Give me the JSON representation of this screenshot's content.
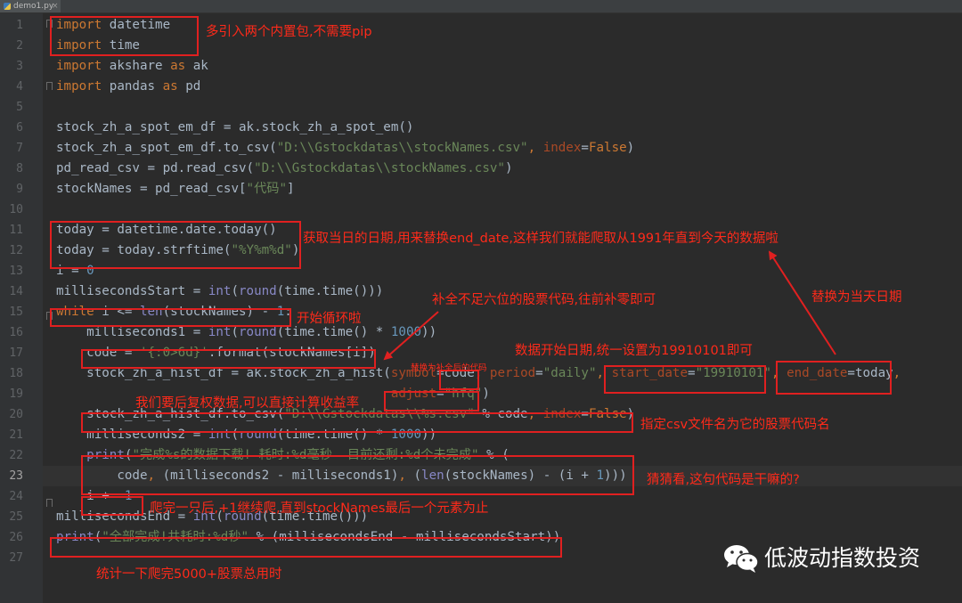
{
  "tab": {
    "filename": "demo1.py",
    "close": "×"
  },
  "editor": {
    "current_line": 23,
    "line_numbers": [
      "1",
      "2",
      "3",
      "4",
      "5",
      "6",
      "7",
      "8",
      "9",
      "10",
      "11",
      "12",
      "13",
      "14",
      "15",
      "16",
      "17",
      "18",
      "19",
      "20",
      "21",
      "22",
      "23",
      "24",
      "25",
      "26",
      "27"
    ],
    "lines": [
      [
        [
          "kw",
          "import"
        ],
        [
          "fx",
          " datetime"
        ]
      ],
      [
        [
          "kw",
          "import"
        ],
        [
          "fx",
          " time"
        ]
      ],
      [
        [
          "kw",
          "import"
        ],
        [
          "fx",
          " akshare "
        ],
        [
          "kw",
          "as"
        ],
        [
          "fx",
          " ak"
        ]
      ],
      [
        [
          "kw",
          "import"
        ],
        [
          "fx",
          " pandas "
        ],
        [
          "kw",
          "as"
        ],
        [
          "fx",
          " pd"
        ]
      ],
      [],
      [
        [
          "fx",
          "stock_zh_a_spot_em_df = ak.stock_zh_a_spot_em()"
        ]
      ],
      [
        [
          "fx",
          "stock_zh_a_spot_em_df.to_csv("
        ],
        [
          "st",
          "\"D:\\\\Gstockdatas\\\\stockNames.csv\""
        ],
        [
          "kw",
          ", "
        ],
        [
          "pr",
          "index"
        ],
        [
          "fx",
          "="
        ],
        [
          "kw",
          "False"
        ],
        [
          "fx",
          ")"
        ]
      ],
      [
        [
          "fx",
          "pd_read_csv = pd.read_csv("
        ],
        [
          "st",
          "\"D:\\\\Gstockdatas\\\\stockNames.csv\""
        ],
        [
          "fx",
          ")"
        ]
      ],
      [
        [
          "fx",
          "stockNames = pd_read_csv["
        ],
        [
          "st",
          "\"代码\""
        ],
        [
          "fx",
          "]"
        ]
      ],
      [],
      [
        [
          "fx",
          "today = datetime.date.today()"
        ]
      ],
      [
        [
          "fx",
          "today = today.strftime("
        ],
        [
          "st",
          "\"%Y%m%d\""
        ],
        [
          "fx",
          ")"
        ]
      ],
      [
        [
          "fx",
          "i = "
        ],
        [
          "nm",
          "0"
        ]
      ],
      [
        [
          "fx",
          "millisecondsStart = "
        ],
        [
          "bi",
          "int"
        ],
        [
          "fx",
          "("
        ],
        [
          "bi",
          "round"
        ],
        [
          "fx",
          "(time.time()))"
        ]
      ],
      [
        [
          "kw",
          "while"
        ],
        [
          "fx",
          " i <= "
        ],
        [
          "bi",
          "len"
        ],
        [
          "fx",
          "(stockNames) - "
        ],
        [
          "nm",
          "1"
        ],
        [
          "fx",
          ":"
        ]
      ],
      [
        [
          "fx",
          "    milliseconds1 = "
        ],
        [
          "bi",
          "int"
        ],
        [
          "fx",
          "("
        ],
        [
          "bi",
          "round"
        ],
        [
          "fx",
          "(time.time() * "
        ],
        [
          "nm",
          "1000"
        ],
        [
          "fx",
          "))"
        ]
      ],
      [
        [
          "fx",
          "    code = "
        ],
        [
          "st",
          "'{:0>6d}'"
        ],
        [
          "fx",
          ".format(stockNames[i])"
        ]
      ],
      [
        [
          "fx",
          "    stock_zh_a_hist_df = ak.stock_zh_a_hist("
        ],
        [
          "pr",
          "symbol"
        ],
        [
          "fx",
          "=code"
        ],
        [
          "kw",
          ", "
        ],
        [
          "pr",
          "period"
        ],
        [
          "fx",
          "="
        ],
        [
          "st",
          "\"daily\""
        ],
        [
          "kw",
          ", "
        ],
        [
          "pr",
          "start_date"
        ],
        [
          "fx",
          "="
        ],
        [
          "st",
          "\"19910101\""
        ],
        [
          "kw",
          ", "
        ],
        [
          "pr",
          "end_date"
        ],
        [
          "fx",
          "=today"
        ],
        [
          "kw",
          ","
        ]
      ],
      [
        [
          "fx",
          "                                            "
        ],
        [
          "pr",
          "adjust"
        ],
        [
          "fx",
          "="
        ],
        [
          "st",
          "\"hfq\""
        ],
        [
          "fx",
          ")"
        ]
      ],
      [
        [
          "fx",
          "    stock_zh_a_hist_df.to_csv("
        ],
        [
          "st",
          "\"D:\\\\Gstockdatas\\\\%s.csv\""
        ],
        [
          "fx",
          " % code"
        ],
        [
          "kw",
          ", "
        ],
        [
          "pr",
          "index"
        ],
        [
          "fx",
          "="
        ],
        [
          "kw",
          "False"
        ],
        [
          "fx",
          ")"
        ]
      ],
      [
        [
          "fx",
          "    milliseconds2 = "
        ],
        [
          "bi",
          "int"
        ],
        [
          "fx",
          "("
        ],
        [
          "bi",
          "round"
        ],
        [
          "fx",
          "(time.time() * "
        ],
        [
          "nm",
          "1000"
        ],
        [
          "fx",
          "))"
        ]
      ],
      [
        [
          "fx",
          "    "
        ],
        [
          "bi",
          "print"
        ],
        [
          "fx",
          "("
        ],
        [
          "st",
          "\"完成%s的数据下载! 耗时:%d毫秒  目前还剩:%d个未完成\""
        ],
        [
          "fx",
          " % ("
        ]
      ],
      [
        [
          "fx",
          "        code"
        ],
        [
          "kw",
          ", "
        ],
        [
          "fx",
          "(milliseconds2 - milliseconds1)"
        ],
        [
          "kw",
          ", "
        ],
        [
          "fx",
          "("
        ],
        [
          "bi",
          "len"
        ],
        [
          "fx",
          "(stockNames) - (i + "
        ],
        [
          "nm",
          "1"
        ],
        [
          "fx",
          ")))"
        ]
      ],
      [
        [
          "fx",
          "    i += "
        ],
        [
          "nm",
          "1"
        ]
      ],
      [
        [
          "fx",
          "millisecondsEnd = "
        ],
        [
          "bi",
          "int"
        ],
        [
          "fx",
          "("
        ],
        [
          "bi",
          "round"
        ],
        [
          "fx",
          "(time.time()))"
        ]
      ],
      [
        [
          "bi",
          "print"
        ],
        [
          "fx",
          "("
        ],
        [
          "st",
          "\"全部完成!共耗时:%d秒\""
        ],
        [
          "fx",
          " % (millisecondsEnd - millisecondsStart))"
        ]
      ],
      []
    ]
  },
  "annotations": {
    "imports": "多引入两个内置包,不需要pip",
    "today": "获取当日的日期,用来替换end_date,这样我们就能爬取从1991年直到今天的数据啦",
    "replace_today": "替换为当天日期",
    "pad_code": "补全不足六位的股票代码,往前补零即可",
    "loop": "开始循环啦",
    "start_date": "数据开始日期,统一设置为19910101即可",
    "symbol": "替换为补全后的代码",
    "adjust": "我们要后复权数据,可以直接计算收益率",
    "csv_name": "指定csv文件名为它的股票代码名",
    "guess": "猜猜看,这句代码是干嘛的?",
    "increment": "爬完一只后,+1继续爬,直到stockNames最后一个元素为止",
    "total": "统计一下爬完5000+股票总用时"
  },
  "watermark": {
    "text": "低波动指数投资",
    "icon": "wechat-icon"
  },
  "colors": {
    "background": "#2b2b2b",
    "gutter": "#313335",
    "keyword": "#cc7832",
    "string": "#6a8759",
    "number": "#6897bb",
    "builtin": "#8888c6",
    "param": "#aa4926",
    "annotation": "#ff2a1a"
  }
}
